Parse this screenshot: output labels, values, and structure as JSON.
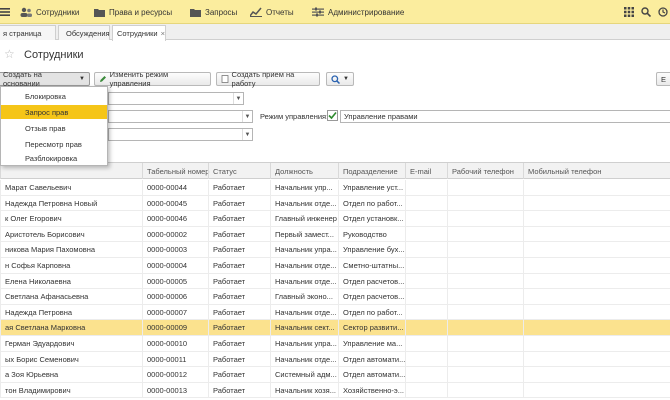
{
  "topbar": {
    "items": [
      {
        "label": "",
        "icon": "menu-icon"
      },
      {
        "label": "Сотрудники",
        "icon": "people-icon"
      },
      {
        "label": "Права и ресурсы",
        "icon": "folder-icon"
      },
      {
        "label": "Запросы",
        "icon": "folder-icon"
      },
      {
        "label": "Отчеты",
        "icon": "chart-icon"
      },
      {
        "label": "Администрирование",
        "icon": "settings-icon"
      }
    ],
    "right_icons": [
      "apps-icon",
      "search-icon",
      "history-icon"
    ]
  },
  "tabs": [
    {
      "label": "я страница",
      "active": false
    },
    {
      "label": "Обсуждения",
      "active": false
    },
    {
      "label": "Сотрудники",
      "active": true,
      "close": "×"
    }
  ],
  "page": {
    "title": "Сотрудники",
    "star": "☆"
  },
  "toolbar": {
    "create_on_basis": "Создать на основании",
    "change_mode": "Изменить режим управления",
    "create_hire": "Создать прием на работу",
    "search_button": "🔍",
    "right_button": "Е"
  },
  "filters": {
    "mode_label": "Режим управления:",
    "mode_value": "Управление правами",
    "mode_checked": true
  },
  "dropdown": {
    "items": [
      "Блокировка",
      "Запрос прав",
      "Отзыв прав",
      "Пересмотр прав",
      "Разблокировка"
    ],
    "selected_index": 1
  },
  "grid": {
    "columns": [
      "",
      "Табельный номер",
      "Статус",
      "Должность",
      "Подразделение",
      "E-mail",
      "Рабочий телефон",
      "Мобильный телефон"
    ],
    "rows": [
      [
        "Марат Савельевич",
        "0000-00044",
        "Работает",
        "Начальник упр...",
        "Управление уст...",
        "",
        "",
        ""
      ],
      [
        "Надежда Петровна Новый",
        "0000-00045",
        "Работает",
        "Начальник отде...",
        "Отдел по работ...",
        "",
        "",
        ""
      ],
      [
        "к Олег Егорович",
        "0000-00046",
        "Работает",
        "Главный инженер",
        "Отдел установк...",
        "",
        "",
        ""
      ],
      [
        "Аристотель Борисович",
        "0000-00002",
        "Работает",
        "Первый замест...",
        "Руководство",
        "",
        "",
        ""
      ],
      [
        "никова Мария Пахомовна",
        "0000-00003",
        "Работает",
        "Начальник упра...",
        "Управление бух...",
        "",
        "",
        ""
      ],
      [
        "н Софья Карповна",
        "0000-00004",
        "Работает",
        "Начальник отде...",
        "Сметно-штатны...",
        "",
        "",
        ""
      ],
      [
        "Елена Николаевна",
        "0000-00005",
        "Работает",
        "Начальник отде...",
        "Отдел расчетов...",
        "",
        "",
        ""
      ],
      [
        "Светлана Афанасьевна",
        "0000-00006",
        "Работает",
        "Главный эконо...",
        "Отдел расчетов...",
        "",
        "",
        ""
      ],
      [
        "Надежда Петровна",
        "0000-00007",
        "Работает",
        "Начальник отде...",
        "Отдел по работ...",
        "",
        "",
        ""
      ],
      [
        "ая Светлана Марковна",
        "0000-00009",
        "Работает",
        "Начальник сект...",
        "Сектор развити...",
        "",
        "",
        ""
      ],
      [
        "Герман Эдуардович",
        "0000-00010",
        "Работает",
        "Начальник упра...",
        "Управление ма...",
        "",
        "",
        ""
      ],
      [
        "ых Борис Семенович",
        "0000-00011",
        "Работает",
        "Начальник отде...",
        "Отдел автомати...",
        "",
        "",
        ""
      ],
      [
        "а Зоя Юрьевна",
        "0000-00012",
        "Работает",
        "Системный адм...",
        "Отдел автомати...",
        "",
        "",
        ""
      ],
      [
        "тон Владимирович",
        "0000-00013",
        "Работает",
        "Начальник хозя...",
        "Хозяйственно-э...",
        "",
        "",
        ""
      ]
    ],
    "selected_row": 9
  },
  "colors": {
    "topbar": "#fbed9e",
    "selection": "#f5c518",
    "row_selected": "#fbe28e"
  }
}
